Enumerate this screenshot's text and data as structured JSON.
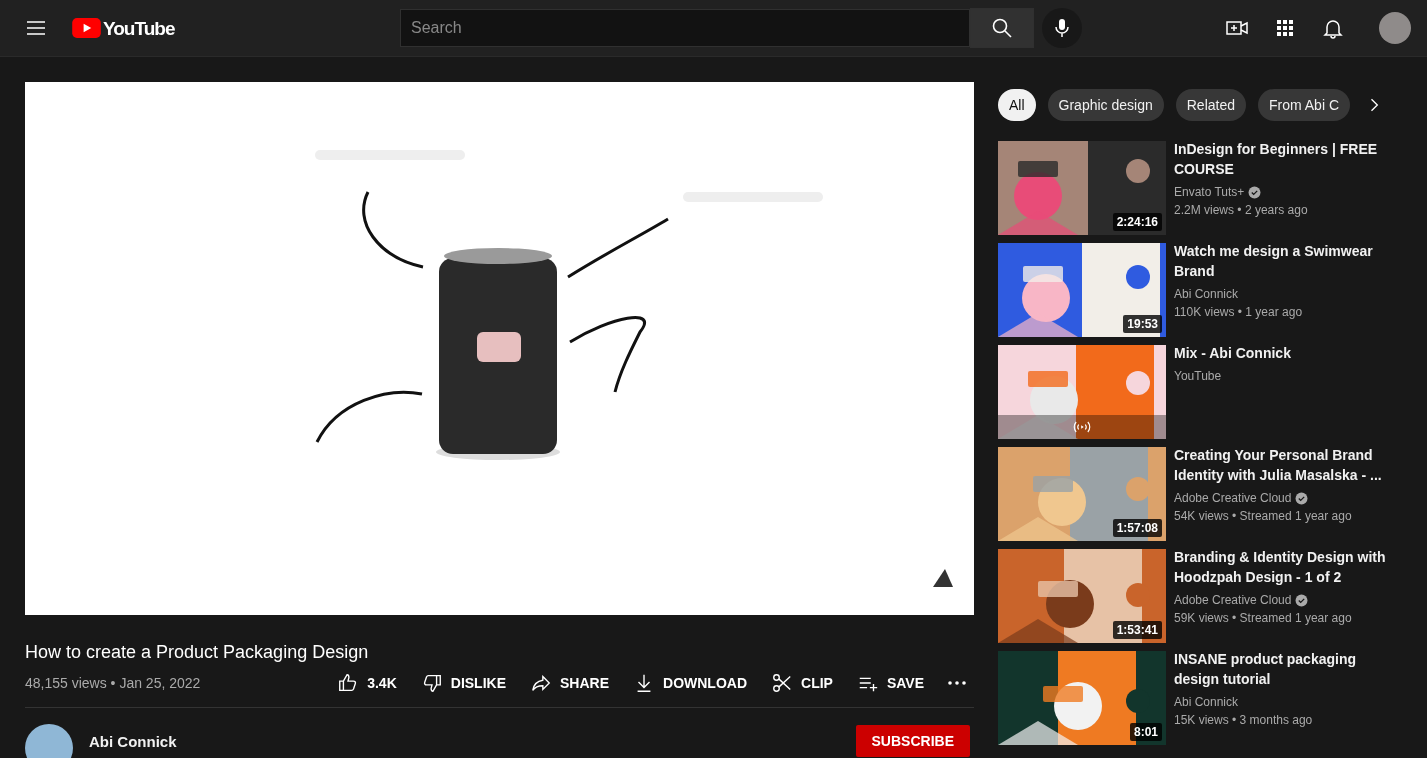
{
  "header": {
    "logo": "YouTube",
    "search": {
      "placeholder": "Search"
    }
  },
  "video": {
    "kind": "picture",
    "title": "How to create a Product Packaging Design",
    "stats": "48,155 views • Jan 25, 2022",
    "actions": [
      {
        "kind": "like",
        "label": "3.4K"
      },
      {
        "kind": "dislike",
        "label": "DISLIKE"
      },
      {
        "kind": "share",
        "label": "SHARE"
      },
      {
        "kind": "download",
        "label": "DOWNLOAD"
      },
      {
        "kind": "clip",
        "label": "CLIP"
      },
      {
        "kind": "save",
        "label": "SAVE"
      },
      {
        "kind": "more"
      }
    ],
    "channel": {
      "name": "Abi Connick",
      "subscribe": "SUBSCRIBE"
    }
  },
  "sidebar": {
    "chips": [
      {
        "label": "All",
        "selected": true
      },
      {
        "label": "Graphic design",
        "selected": false
      },
      {
        "label": "Related",
        "selected": false
      },
      {
        "label": "From Abi C",
        "selected": false
      }
    ],
    "videos": [
      {
        "kind": "video",
        "title": "InDesign for Beginners | FREE COURSE",
        "channel": "Envato Tuts+",
        "verified": true,
        "meta": "2.2M views • 2 years ago",
        "duration": "2:24:16"
      },
      {
        "kind": "video",
        "title": "Watch me design a Swimwear Brand",
        "channel": "Abi Connick",
        "verified": false,
        "meta": "110K views • 1 year ago",
        "duration": "19:53"
      },
      {
        "kind": "mix",
        "title": "Mix - Abi Connick",
        "channel": "YouTube",
        "verified": false
      },
      {
        "kind": "video",
        "title": "Creating Your Personal Brand Identity with Julia Masalska - ...",
        "channel": "Adobe Creative Cloud",
        "verified": true,
        "meta": "54K views • Streamed 1 year ago",
        "duration": "1:57:08"
      },
      {
        "kind": "video",
        "title": "Branding & Identity Design with Hoodzpah Design - 1 of 2",
        "channel": "Adobe Creative Cloud",
        "verified": true,
        "meta": "59K views • Streamed 1 year ago",
        "duration": "1:53:41"
      },
      {
        "kind": "video",
        "title": "INSANE product packaging design tutorial",
        "channel": "Abi Connick",
        "verified": false,
        "meta": "15K views • 3 months ago",
        "duration": "8:01"
      }
    ]
  }
}
